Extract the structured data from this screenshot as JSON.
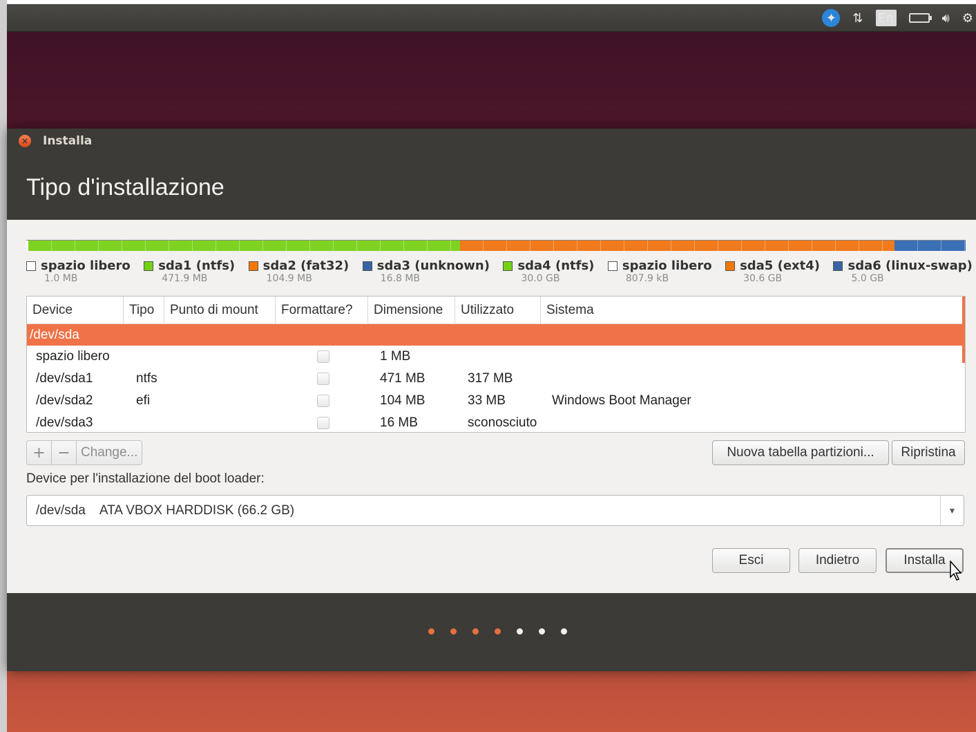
{
  "top_panel": {
    "icons": [
      "accessibility-icon",
      "network-icon",
      "keyboard-layout-icon",
      "battery-icon",
      "volume-icon",
      "settings-icon"
    ],
    "lang": "En"
  },
  "window": {
    "title": "Installa",
    "heading": "Tipo d'installazione"
  },
  "partition_bar": {
    "segments": [
      {
        "color": "#ffffff",
        "share": 0.2
      },
      {
        "color": "#7ed321",
        "share": 46.0
      },
      {
        "color": "#f07a1c",
        "share": 46.2
      },
      {
        "color": "#3b6fb6",
        "share": 7.6
      }
    ]
  },
  "legend": [
    {
      "name": "spazio libero",
      "size": "1.0 MB",
      "color": "#ffffff"
    },
    {
      "name": "sda1 (ntfs)",
      "size": "471.9 MB",
      "color": "#73d216"
    },
    {
      "name": "sda2 (fat32)",
      "size": "104.9 MB",
      "color": "#f57900"
    },
    {
      "name": "sda3 (unknown)",
      "size": "16.8 MB",
      "color": "#3465a4"
    },
    {
      "name": "sda4 (ntfs)",
      "size": "30.0 GB",
      "color": "#73d216"
    },
    {
      "name": "spazio libero",
      "size": "807.9 kB",
      "color": "#ffffff"
    },
    {
      "name": "sda5 (ext4)",
      "size": "30.6 GB",
      "color": "#f57900"
    },
    {
      "name": "sda6 (linux-swap)",
      "size": "5.0 GB",
      "color": "#3465a4"
    }
  ],
  "table": {
    "headers": [
      "Device",
      "Tipo",
      "Punto di mount",
      "Formattare?",
      "Dimensione",
      "Utilizzato",
      "Sistema"
    ],
    "selected_row": "/dev/sda",
    "rows": [
      {
        "device": "spazio libero",
        "tipo": "",
        "mount": "",
        "size": "1 MB",
        "used": "",
        "system": ""
      },
      {
        "device": "/dev/sda1",
        "tipo": "ntfs",
        "mount": "",
        "size": "471 MB",
        "used": "317 MB",
        "system": ""
      },
      {
        "device": "/dev/sda2",
        "tipo": "efi",
        "mount": "",
        "size": "104 MB",
        "used": "33 MB",
        "system": "Windows Boot Manager"
      },
      {
        "device": "/dev/sda3",
        "tipo": "",
        "mount": "",
        "size": "16 MB",
        "used": "sconosciuto",
        "system": ""
      }
    ]
  },
  "toolbar": {
    "add": "+",
    "remove": "−",
    "change": "Change...",
    "new_table": "Nuova tabella partizioni...",
    "revert": "Ripristina"
  },
  "bootloader": {
    "label": "Device per l'installazione del boot loader:",
    "device": "/dev/sda",
    "description": "ATA VBOX HARDDISK (66.2 GB)"
  },
  "actions": {
    "quit": "Esci",
    "back": "Indietro",
    "install": "Installa"
  },
  "progress": {
    "total_steps": 7,
    "completed_steps": 4
  }
}
